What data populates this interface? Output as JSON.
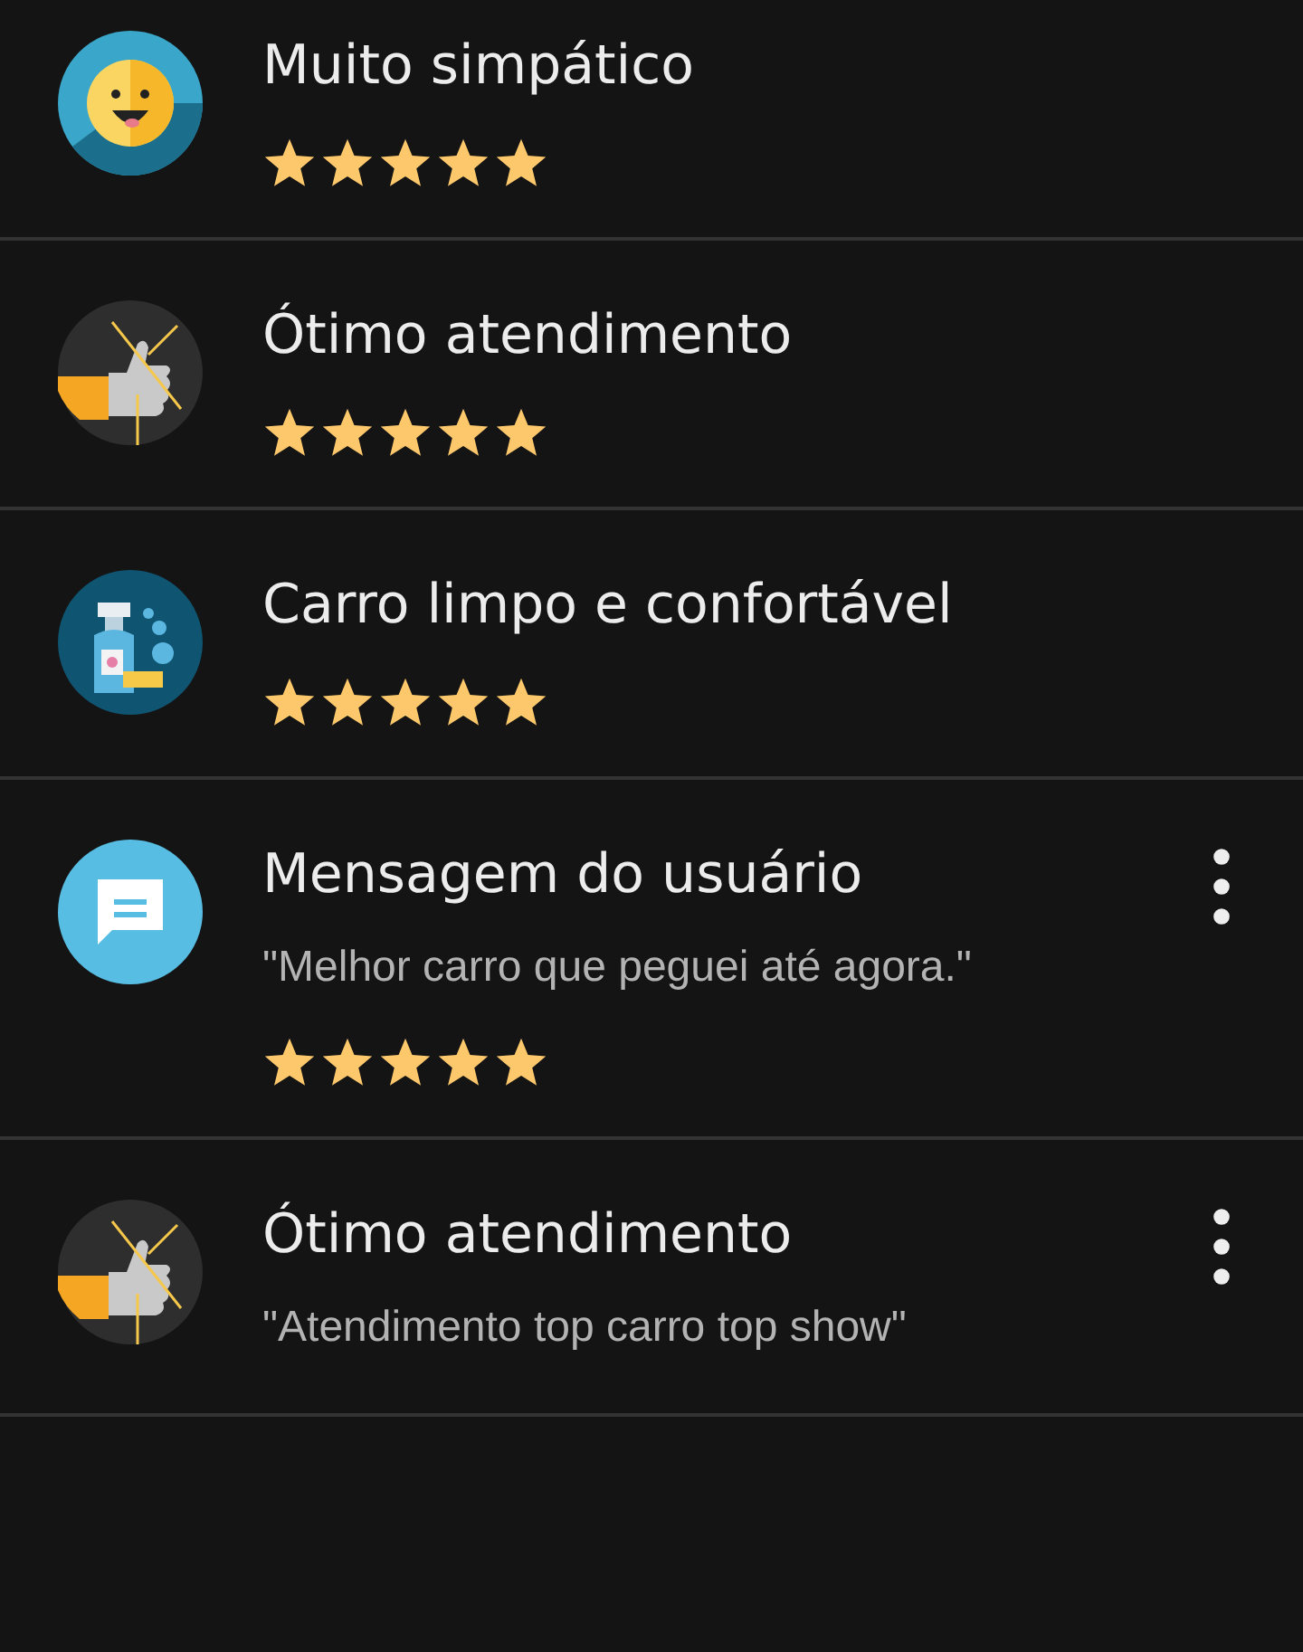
{
  "rows": [
    {
      "badge": {
        "kind": "smile"
      },
      "title": "Muito simpático",
      "stars": 5,
      "menu": false
    },
    {
      "badge": {
        "kind": "thumb"
      },
      "title": "Ótimo atendimento",
      "stars": 5,
      "menu": false
    },
    {
      "badge": {
        "kind": "cleaning"
      },
      "title": "Carro limpo e confortável",
      "stars": 5,
      "menu": false
    },
    {
      "badge": {
        "kind": "message"
      },
      "title": "Mensagem do usuário",
      "comment": "\"Melhor carro que peguei até agora.\"",
      "stars": 5,
      "menu": true
    },
    {
      "badge": {
        "kind": "thumb"
      },
      "title": "Ótimo atendimento",
      "comment": "\"Atendimento top carro top show\"",
      "menu": true
    }
  ]
}
